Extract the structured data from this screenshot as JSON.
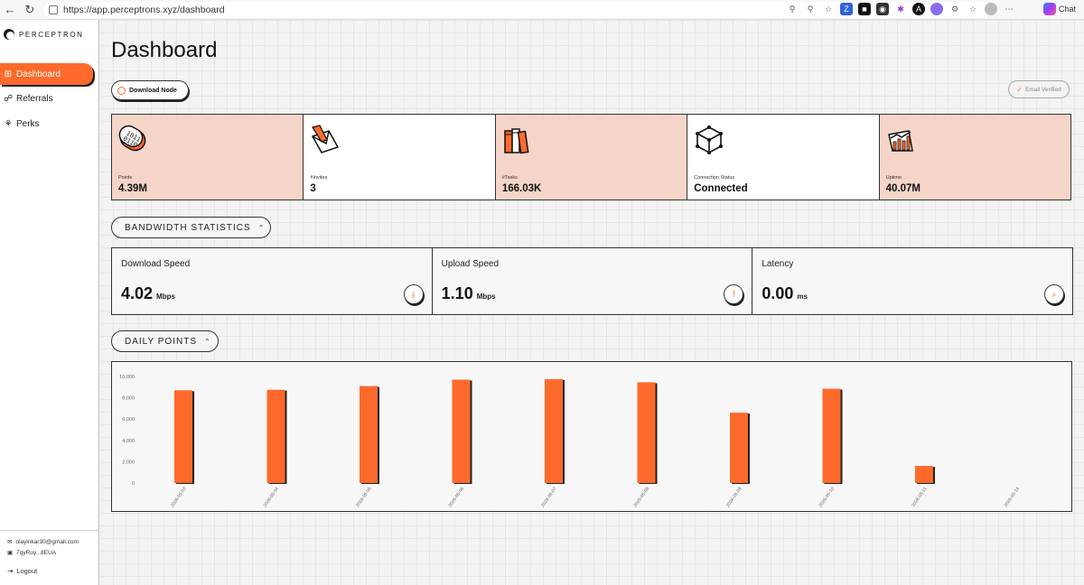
{
  "browser": {
    "url": "https://app.perceptrons.xyz/dashboard",
    "chat_label": "Chat"
  },
  "sidebar": {
    "brand": "PERCEPTRON",
    "items": [
      {
        "label": "Dashboard",
        "icon": "grid-icon"
      },
      {
        "label": "Referrals",
        "icon": "link-icon"
      },
      {
        "label": "Perks",
        "icon": "trophy-icon"
      }
    ],
    "email": "olayinkar30@gmail.com",
    "wallet": "7qyRuy...8EUA",
    "logout": "Logout"
  },
  "page": {
    "title": "Dashboard",
    "download_node": "Download Node",
    "email_verified": "Email Verified"
  },
  "stats": [
    {
      "label": "Points",
      "value": "4.39M",
      "icon": "binary-icon"
    },
    {
      "label": "#Invites",
      "value": "3",
      "icon": "envelope-icon"
    },
    {
      "label": "#Tasks",
      "value": "166.03K",
      "icon": "books-icon"
    },
    {
      "label": "Connection Status",
      "value": "Connected",
      "icon": "network-cube-icon"
    },
    {
      "label": "Uptime",
      "value": "40.07M",
      "icon": "chart-trend-icon"
    }
  ],
  "bandwidth": {
    "title": "BANDWIDTH STATISTICS",
    "items": [
      {
        "label": "Download Speed",
        "value": "4.02",
        "unit": "Mbps",
        "icon": "download-icon"
      },
      {
        "label": "Upload Speed",
        "value": "1.10",
        "unit": "Mbps",
        "icon": "upload-icon"
      },
      {
        "label": "Latency",
        "value": "0.00",
        "unit": "ms",
        "icon": "wifi-icon"
      }
    ]
  },
  "daily": {
    "title": "DAILY POINTS"
  },
  "colors": {
    "accent": "#fe6a2b",
    "peach": "#f5d5c8"
  },
  "chart_data": {
    "type": "bar",
    "categories": [
      "2026-05-03",
      "2026-05-04",
      "2026-05-05",
      "2026-05-06",
      "2026-05-07",
      "2026-05-08",
      "2026-05-09",
      "2026-05-10",
      "2026-05-11",
      "2026-05-14"
    ],
    "values": [
      8700,
      8750,
      9100,
      9700,
      9750,
      9450,
      6600,
      8850,
      1600,
      0
    ],
    "yticks": [
      0,
      2000,
      4000,
      6000,
      8000,
      10000
    ],
    "ytick_labels": [
      "0",
      "2,000",
      "4,000",
      "6,000",
      "8,000",
      "10,000"
    ],
    "ylim": [
      0,
      10000
    ],
    "grid": false,
    "legend": "none"
  }
}
